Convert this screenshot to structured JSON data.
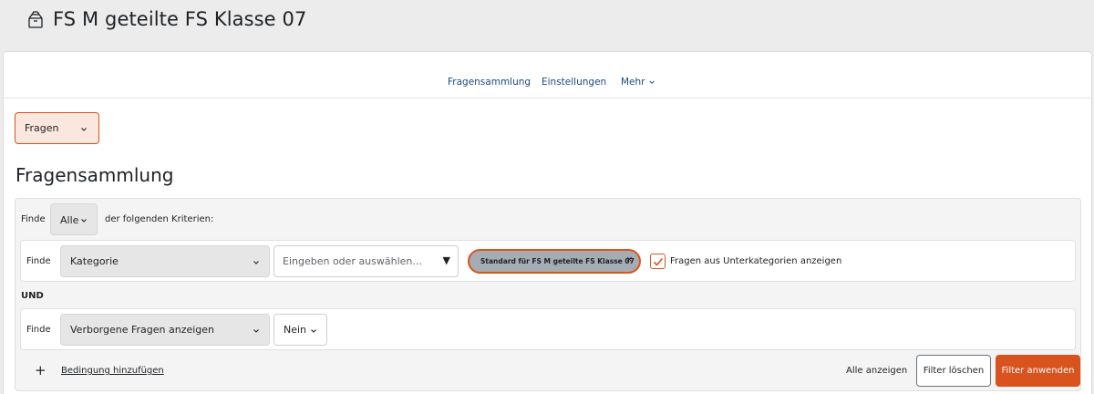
{
  "header": {
    "title": "FS M geteilte FS Klasse 07",
    "icon": "course-box-icon"
  },
  "secondary_nav": {
    "items": [
      {
        "label": "Fragensammlung"
      },
      {
        "label": "Einstellungen"
      },
      {
        "label": "Mehr"
      }
    ]
  },
  "bank_select": {
    "value": "Fragen"
  },
  "page_title": "Fragensammlung",
  "filter": {
    "match_prefix": "Finde",
    "match_value": "Alle",
    "match_suffix": "der folgenden Kriterien:",
    "conditions": [
      {
        "prefix": "Finde",
        "field": "Kategorie",
        "search_placeholder": "Eingeben oder auswählen...",
        "selected_chip": "Standard für FS M geteilte FS Klasse 07",
        "chip_remove": "×",
        "subcategories_label": "Fragen aus Unterkategorien anzeigen",
        "subcategories_checked": true
      },
      {
        "prefix": "Finde",
        "field": "Verborgene Fragen anzeigen",
        "value": "Nein"
      }
    ],
    "join_label": "UND",
    "add_condition": "Bedingung hinzufügen",
    "show_all": "Alle anzeigen",
    "clear_button": "Filter löschen",
    "apply_button": "Filter anwenden"
  },
  "colors": {
    "accent": "#d9531e",
    "link": "#1d4a7a",
    "chip_bg": "#a6acb3"
  }
}
